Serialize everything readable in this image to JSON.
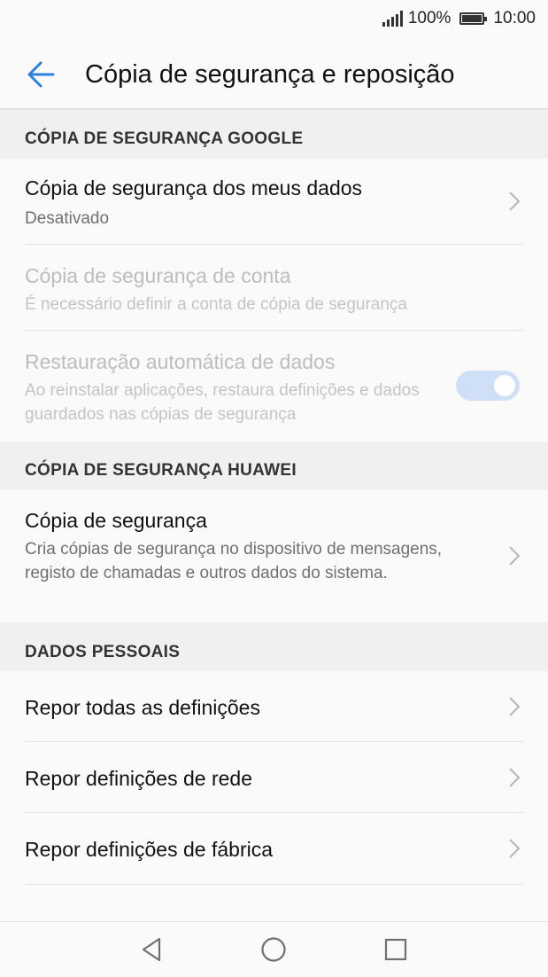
{
  "status": {
    "battery_text": "100%",
    "time": "10:00"
  },
  "appbar": {
    "title": "Cópia de segurança e reposição"
  },
  "sections": {
    "google": {
      "header": "CÓPIA DE SEGURANÇA GOOGLE",
      "backup_my_data": {
        "title": "Cópia de segurança dos meus dados",
        "subtitle": "Desativado"
      },
      "backup_account": {
        "title": "Cópia de segurança de conta",
        "subtitle": "É necessário definir a conta de cópia de segurança"
      },
      "auto_restore": {
        "title": "Restauração automática de dados",
        "subtitle": "Ao reinstalar aplicações, restaura definições e dados guardados nas cópias de segurança",
        "toggle_on": true
      }
    },
    "huawei": {
      "header": "CÓPIA DE SEGURANÇA HUAWEI",
      "backup": {
        "title": "Cópia de segurança",
        "subtitle": "Cria cópias de segurança no dispositivo de mensagens, registo de chamadas e outros dados do sistema."
      }
    },
    "personal": {
      "header": "DADOS PESSOAIS",
      "reset_all": {
        "title": "Repor todas as definições"
      },
      "reset_network": {
        "title": "Repor definições de rede"
      },
      "factory_reset": {
        "title": "Repor definições de fábrica"
      }
    }
  },
  "colors": {
    "accent": "#2f7fd8",
    "toggle_track": "#cfe0f6",
    "section_bg": "#f0f0f0"
  },
  "icons": {
    "back": "arrow-left-icon",
    "chevron": "chevron-right-icon",
    "nav_back": "triangle-back-icon",
    "nav_home": "circle-home-icon",
    "nav_recents": "square-recents-icon"
  }
}
